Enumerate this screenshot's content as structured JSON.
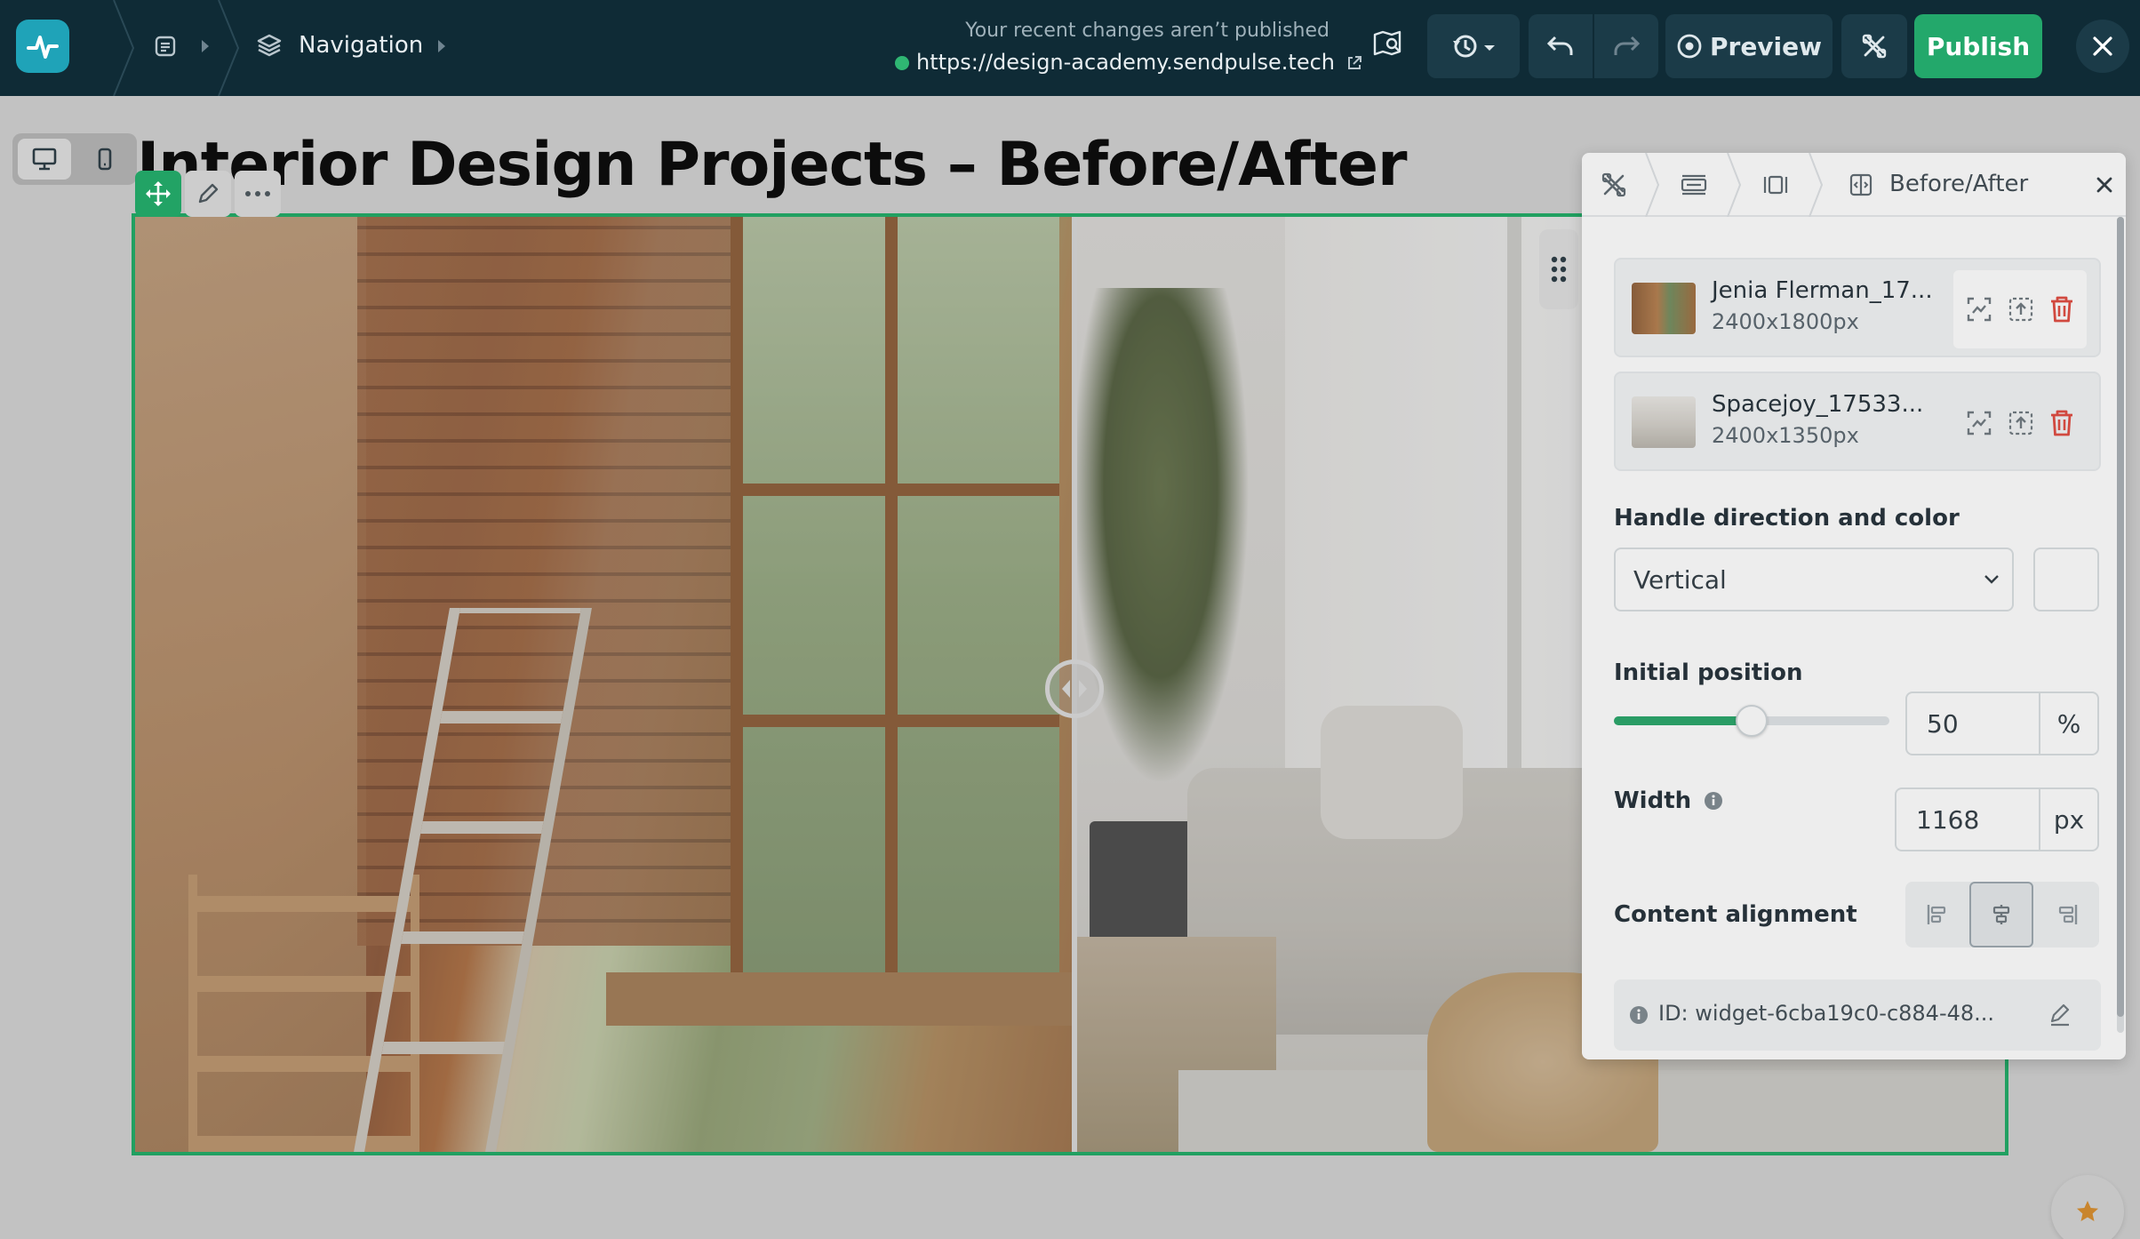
{
  "topbar": {
    "breadcrumb_section": "Navigation",
    "status": "Your recent changes aren’t published",
    "url": "https://design-academy.sendpulse.tech",
    "preview_label": "Preview",
    "publish_label": "Publish"
  },
  "page": {
    "title": "Interior Design Projects – Before/After"
  },
  "widget": {
    "handle_position_pct": 50
  },
  "panel": {
    "breadcrumb_title": "Before/After",
    "images": [
      {
        "name": "Jenia Flerman_17...",
        "size": "2400x1800px"
      },
      {
        "name": "Spacejoy_17533...",
        "size": "2400x1350px"
      }
    ],
    "handle_label": "Handle direction and color",
    "handle_direction": "Vertical",
    "initial_position_label": "Initial position",
    "initial_position_value": "50",
    "initial_position_unit": "%",
    "width_label": "Width",
    "width_value": "1168",
    "width_unit": "px",
    "content_alignment_label": "Content alignment",
    "id_text": "ID: widget-6cba19c0-c884-48..."
  },
  "colors": {
    "topbar_bg": "#0f2b36",
    "accent_green": "#22a365",
    "delete_red": "#e0453a"
  }
}
